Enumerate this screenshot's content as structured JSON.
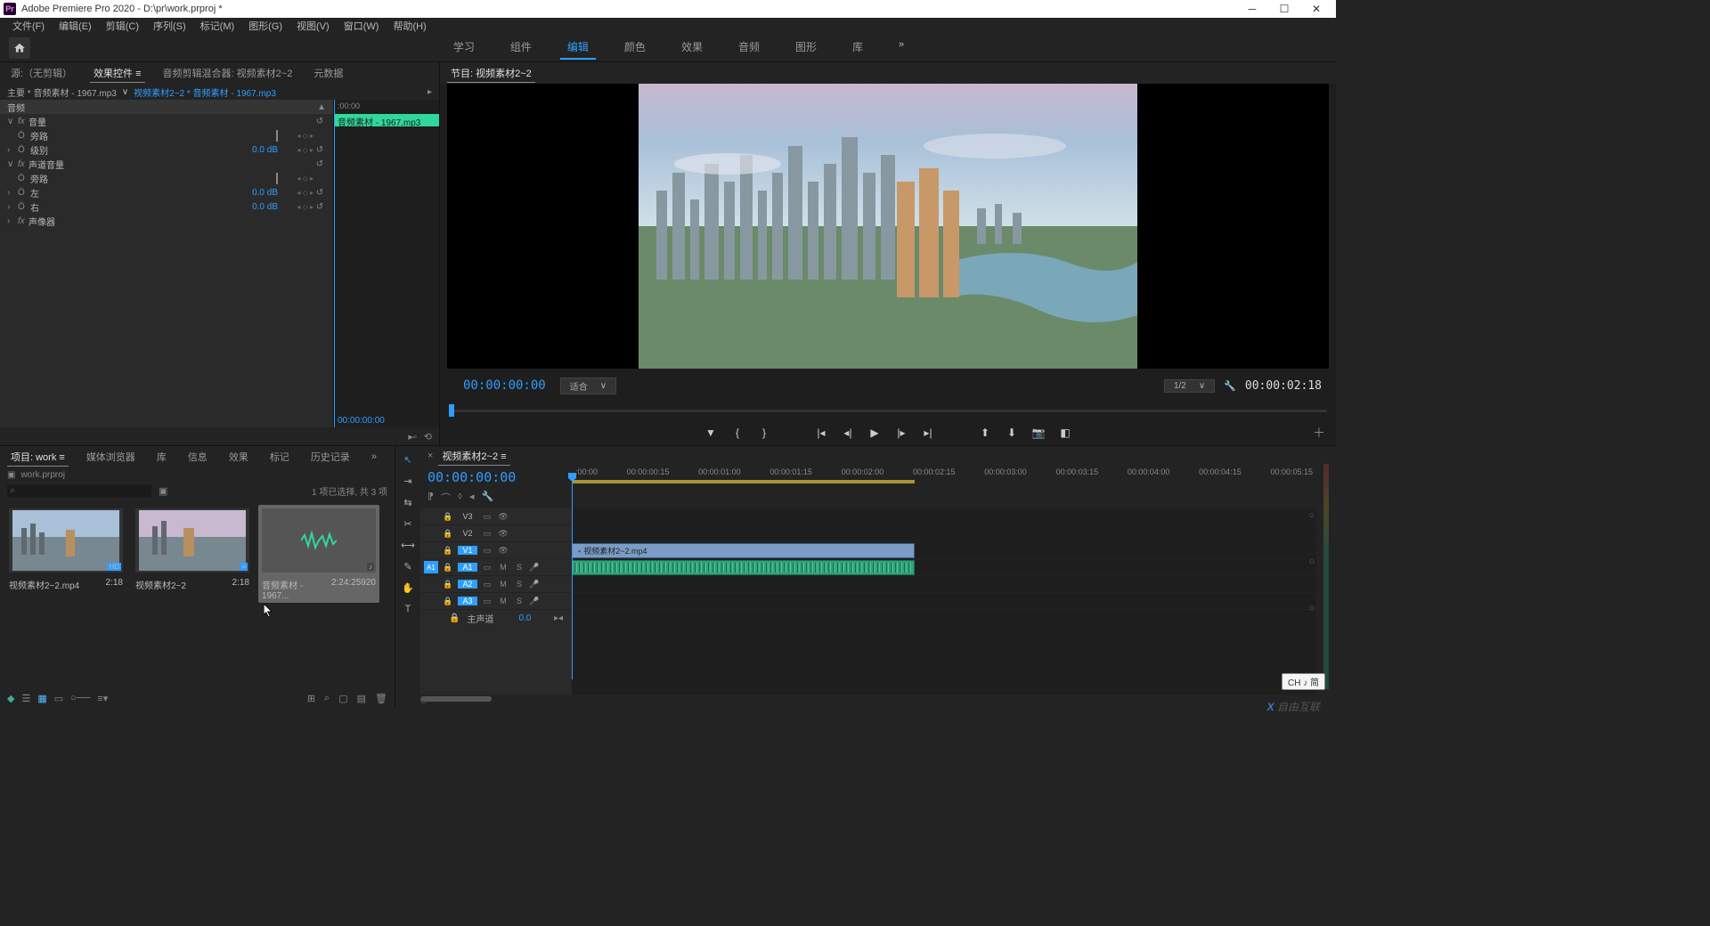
{
  "titlebar": {
    "app_icon_text": "Pr",
    "title": "Adobe Premiere Pro 2020 - D:\\pr\\work.prproj *"
  },
  "menu": [
    "文件(F)",
    "编辑(E)",
    "剪辑(C)",
    "序列(S)",
    "标记(M)",
    "图形(G)",
    "视图(V)",
    "窗口(W)",
    "帮助(H)"
  ],
  "workspace": {
    "tabs": [
      "学习",
      "组件",
      "编辑",
      "颜色",
      "效果",
      "音频",
      "图形",
      "库"
    ],
    "active_index": 2,
    "more": "»"
  },
  "source_panel": {
    "tabs": [
      "源:（无剪辑）",
      "效果控件 ≡",
      "音频剪辑混合器: 视频素材2~2",
      "元数据"
    ],
    "active_index": 1,
    "breadcrumb_src": "主要 * 音频素材 - 1967.mp3",
    "breadcrumb_sep": "∨",
    "breadcrumb_tgt": "视频素材2~2 * 音频素材 - 1967.mp3",
    "ec_time": ":00:00",
    "ec_clip": "音频素材 - 1967.mp3",
    "rows": [
      {
        "type": "section",
        "name": "音频"
      },
      {
        "type": "fx",
        "name": "音量",
        "reset": "↺"
      },
      {
        "type": "prop",
        "stopwatch": "Ö",
        "name": "旁路",
        "checkbox": true,
        "keynav": true
      },
      {
        "type": "prop",
        "expand": ">",
        "stopwatch": "Ö",
        "name": "级别",
        "val": "0.0 dB",
        "keynav": true,
        "reset": "↺"
      },
      {
        "type": "fx",
        "name": "声道音量",
        "reset": "↺"
      },
      {
        "type": "prop",
        "stopwatch": "Ö",
        "name": "旁路",
        "checkbox": true,
        "keynav": true
      },
      {
        "type": "prop",
        "expand": ">",
        "stopwatch": "Ö",
        "name": "左",
        "val": "0.0 dB",
        "keynav": true,
        "reset": "↺"
      },
      {
        "type": "prop",
        "expand": ">",
        "stopwatch": "Ö",
        "name": "右",
        "val": "0.0 dB",
        "keynav": true,
        "reset": "↺"
      },
      {
        "type": "fx",
        "expand": ">",
        "name": "声像器"
      }
    ],
    "footer_tc": "00:00:00:00"
  },
  "program_panel": {
    "tab": "节目: 视频素材2~2",
    "current_tc": "00:00:00:00",
    "fit": "适合",
    "res": "1/2",
    "duration": "00:00:02:18"
  },
  "project_panel": {
    "tabs": [
      "项目: work ≡",
      "媒体浏览器",
      "库",
      "信息",
      "效果",
      "标记",
      "历史记录",
      "»"
    ],
    "active_index": 0,
    "bin_name": "work.prproj",
    "search_placeholder": "",
    "status": "1 项已选择, 共 3 项",
    "items": [
      {
        "name": "视频素材2~2.mp4",
        "dur": "2:18",
        "type": "video"
      },
      {
        "name": "视频素材2~2",
        "dur": "2:18",
        "type": "seq"
      },
      {
        "name": "音频素材 - 1967...",
        "dur": "2:24:25920",
        "type": "audio",
        "selected": true
      }
    ]
  },
  "timeline": {
    "tab": "视频素材2~2 ≡",
    "tc": "00:00:00:00",
    "ruler": [
      ":00:00",
      "00:00:00:15",
      "00:00:01:00",
      "00:00:01:15",
      "00:00:02:00",
      "00:00:02:15",
      "00:00:03:00",
      "00:00:03:15",
      "00:00:04:00",
      "00:00:04:15",
      "00:00:05:15"
    ],
    "video_tracks": [
      "V3",
      "V2",
      "V1"
    ],
    "audio_tracks": [
      "A1",
      "A2",
      "A3"
    ],
    "source_patches": {
      "v": "",
      "a": "A1"
    },
    "clip_video": "视频素材2~2.mp4",
    "master": "主声道",
    "master_val": "0.0"
  },
  "ime": "CH ♪ 简",
  "watermark": "自由互联"
}
